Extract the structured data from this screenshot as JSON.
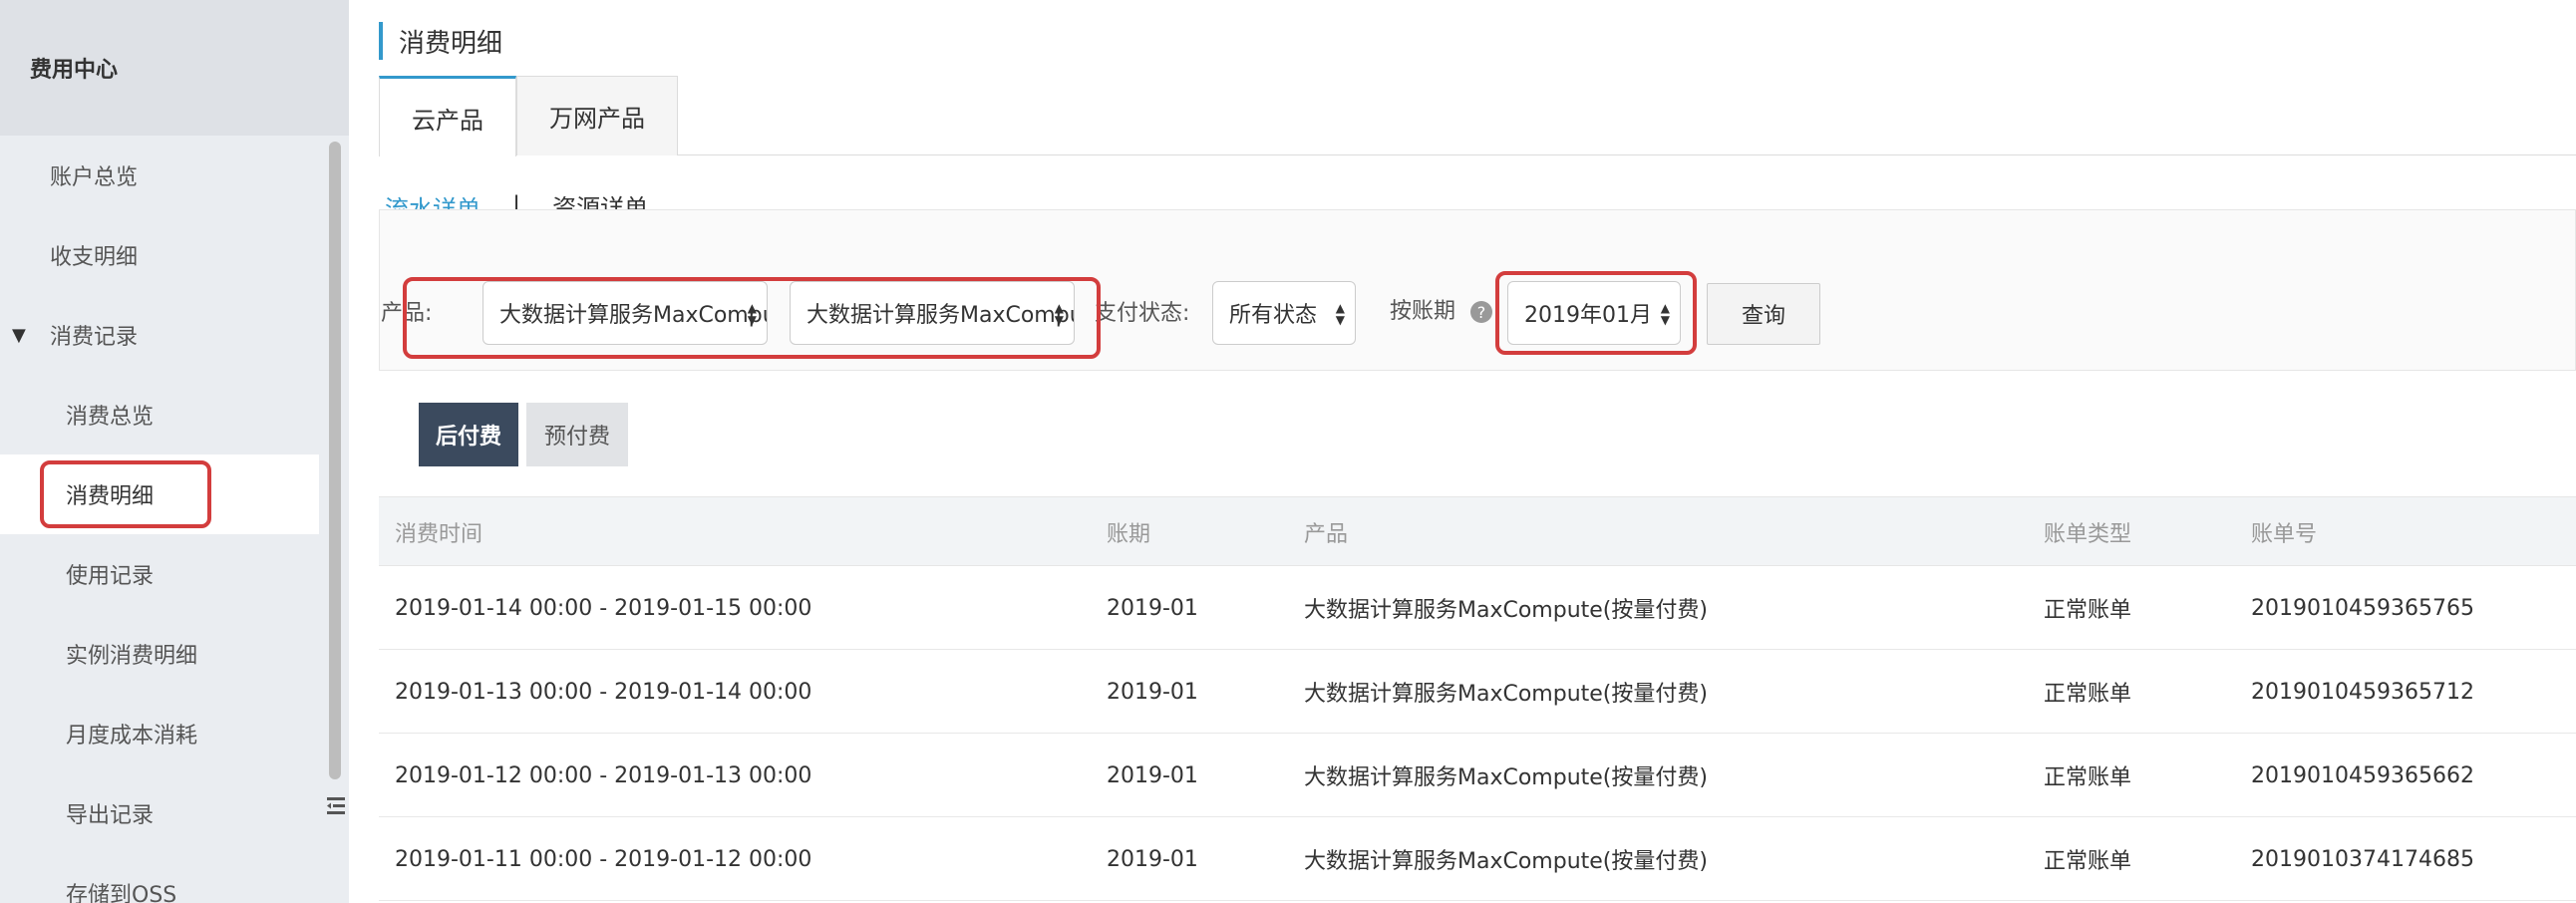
{
  "sidebar": {
    "title": "费用中心",
    "items": [
      {
        "label": "账户总览"
      },
      {
        "label": "收支明细"
      },
      {
        "label": "消费记录"
      },
      {
        "label": "消费总览"
      },
      {
        "label": "消费明细"
      },
      {
        "label": "使用记录"
      },
      {
        "label": "实例消费明细"
      },
      {
        "label": "月度成本消耗"
      },
      {
        "label": "导出记录"
      },
      {
        "label": "存储到OSS"
      }
    ]
  },
  "main": {
    "page_title": "消费明细",
    "tabs": [
      {
        "label": "云产品"
      },
      {
        "label": "万网产品"
      }
    ],
    "subtabs": [
      {
        "label": "流水详单"
      },
      {
        "label": "资源详单"
      }
    ],
    "subtab_separator": "|",
    "filters": {
      "product_label": "产品:",
      "product_select_1": "大数据计算服务MaxCompute",
      "product_select_2": "大数据计算服务MaxCompute",
      "pay_status_label": "支付状态:",
      "pay_status_value": "所有状态",
      "period_label": "按账期",
      "period_value": "2019年01月",
      "query_button": "查询"
    },
    "pay_types": [
      {
        "label": "后付费"
      },
      {
        "label": "预付费"
      }
    ],
    "table": {
      "columns": [
        "消费时间",
        "账期",
        "产品",
        "账单类型",
        "账单号"
      ],
      "rows": [
        [
          "2019-01-14 00:00 - 2019-01-15 00:00",
          "2019-01",
          "大数据计算服务MaxCompute(按量付费)",
          "正常账单",
          "2019010459365765"
        ],
        [
          "2019-01-13 00:00 - 2019-01-14 00:00",
          "2019-01",
          "大数据计算服务MaxCompute(按量付费)",
          "正常账单",
          "2019010459365712"
        ],
        [
          "2019-01-12 00:00 - 2019-01-13 00:00",
          "2019-01",
          "大数据计算服务MaxCompute(按量付费)",
          "正常账单",
          "2019010459365662"
        ],
        [
          "2019-01-11 00:00 - 2019-01-12 00:00",
          "2019-01",
          "大数据计算服务MaxCompute(按量付费)",
          "正常账单",
          "2019010374174685"
        ]
      ]
    }
  },
  "colors": {
    "accent": "#3399cc",
    "highlight": "#d33d3d",
    "active_pay": "#3b4a5e"
  },
  "icons": {
    "expand_caret": "caret-down-icon",
    "help": "question-circle-icon",
    "select_arrows": "sort-arrows-icon",
    "collapse": "collapse-sidebar-icon"
  }
}
